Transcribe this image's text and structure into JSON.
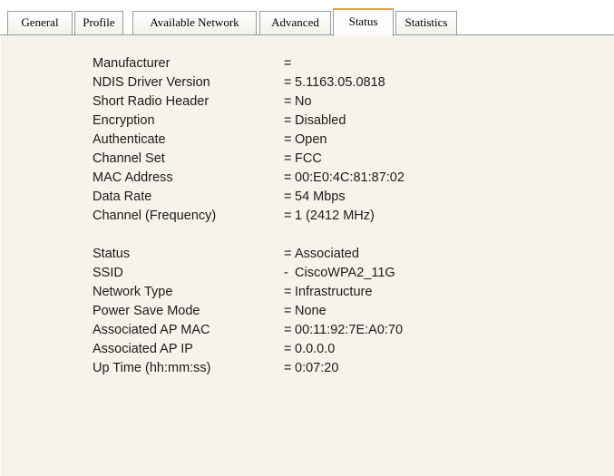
{
  "tabs": [
    {
      "label": "General",
      "active": false
    },
    {
      "label": "Profile",
      "active": false
    },
    {
      "label": "Available Network",
      "active": false
    },
    {
      "label": "Advanced",
      "active": false
    },
    {
      "label": "Status",
      "active": true
    },
    {
      "label": "Statistics",
      "active": false
    }
  ],
  "status_group1": [
    {
      "label": "Manufacturer",
      "separator": "=",
      "value": ""
    },
    {
      "label": "NDIS Driver Version",
      "separator": "=",
      "value": "5.1163.05.0818"
    },
    {
      "label": "Short Radio Header",
      "separator": "=",
      "value": "No"
    },
    {
      "label": "Encryption",
      "separator": "=",
      "value": "Disabled"
    },
    {
      "label": "Authenticate",
      "separator": "=",
      "value": "Open"
    },
    {
      "label": "Channel Set",
      "separator": "=",
      "value": "FCC"
    },
    {
      "label": "MAC Address",
      "separator": "=",
      "value": "00:E0:4C:81:87:02"
    },
    {
      "label": "Data Rate",
      "separator": "=",
      "value": "54 Mbps"
    },
    {
      "label": "Channel (Frequency)",
      "separator": "=",
      "value": "1 (2412 MHz)"
    }
  ],
  "status_group2": [
    {
      "label": "Status",
      "separator": "=",
      "value": "Associated"
    },
    {
      "label": "SSID",
      "separator": "-",
      "value": "CiscoWPA2_11G"
    },
    {
      "label": "Network Type",
      "separator": "=",
      "value": "Infrastructure"
    },
    {
      "label": "Power Save Mode",
      "separator": "=",
      "value": "None"
    },
    {
      "label": "Associated AP MAC",
      "separator": "=",
      "value": "00:11:92:7E:A0:70"
    },
    {
      "label": "Associated AP IP",
      "separator": "=",
      "value": "0.0.0.0"
    },
    {
      "label": "Up Time (hh:mm:ss)",
      "separator": "=",
      "value": "0:07:20"
    }
  ]
}
